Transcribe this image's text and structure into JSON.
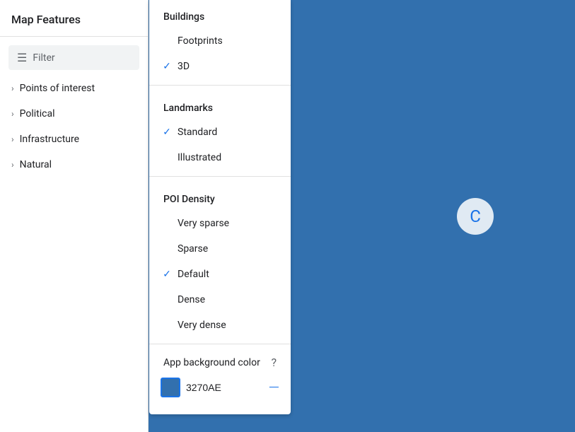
{
  "sidebar": {
    "title": "Map Features",
    "filter_placeholder": "Filter",
    "items": [
      {
        "label": "Points of interest"
      },
      {
        "label": "Political"
      },
      {
        "label": "Infrastructure"
      },
      {
        "label": "Natural"
      }
    ]
  },
  "dropdown": {
    "buildings_header": "Buildings",
    "buildings_items": [
      {
        "label": "Footprints",
        "checked": false
      },
      {
        "label": "3D",
        "checked": true
      }
    ],
    "landmarks_header": "Landmarks",
    "landmarks_items": [
      {
        "label": "Standard",
        "checked": true
      },
      {
        "label": "Illustrated",
        "checked": false
      }
    ],
    "poi_density_header": "POI Density",
    "poi_density_items": [
      {
        "label": "Very sparse",
        "checked": false
      },
      {
        "label": "Sparse",
        "checked": false
      },
      {
        "label": "Default",
        "checked": true
      },
      {
        "label": "Dense",
        "checked": false
      },
      {
        "label": "Very dense",
        "checked": false
      }
    ],
    "app_bg_color_label": "App background color",
    "color_value": "3270AE"
  },
  "icons": {
    "gear": "⚙",
    "filter": "≡",
    "chevron": "›",
    "check": "✓",
    "help": "?",
    "minus": "—",
    "spinner": "C"
  }
}
